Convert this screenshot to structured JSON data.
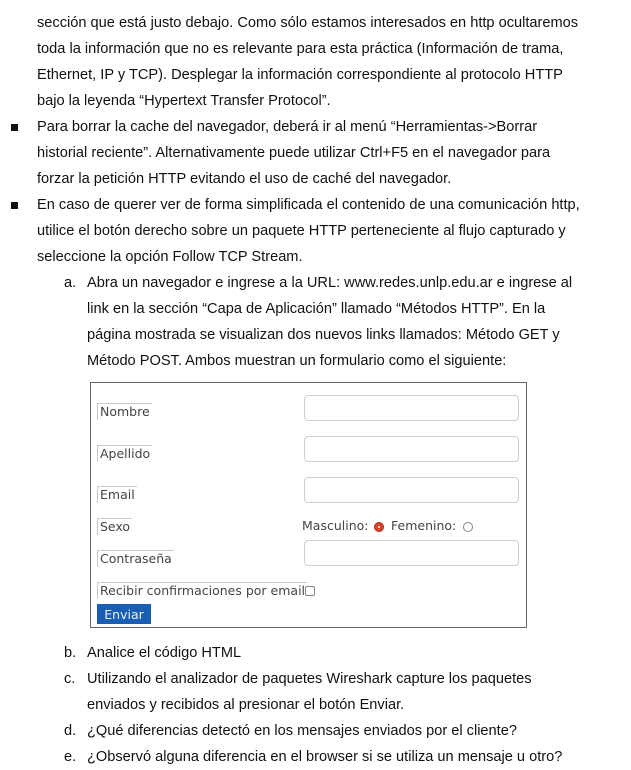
{
  "intro_lines": [
    "sección que está justo debajo. Como sólo estamos interesados en http ocultaremos",
    "toda la información que no es relevante para esta práctica (Información de trama,",
    "Ethernet, IP y TCP). Desplegar la información correspondiente al protocolo HTTP",
    "bajo la leyenda “Hypertext Transfer Protocol”."
  ],
  "bullets": [
    {
      "lines": [
        "Para borrar la cache del navegador, deberá ir al menú “Herramientas->Borrar",
        "historial reciente”. Alternativamente puede utilizar Ctrl+F5 en el navegador para",
        "forzar la petición HTTP evitando el uso de caché del navegador."
      ]
    },
    {
      "lines": [
        "En caso de querer ver de forma simplificada el contenido de una comunicación http,",
        "utilice el botón derecho sobre un paquete HTTP perteneciente al flujo capturado y",
        "seleccione la opción Follow TCP Stream."
      ]
    }
  ],
  "steps": [
    {
      "marker": "a.",
      "lines": [
        "Abra un navegador e ingrese a la URL: www.redes.unlp.edu.ar e ingrese al",
        "link en la sección “Capa de Aplicación” llamado “Métodos HTTP”. En la",
        "página mostrada se visualizan dos nuevos links llamados: Método GET y",
        "Método POST. Ambos muestran un formulario como el siguiente:"
      ]
    },
    {
      "marker": "b.",
      "lines": [
        "Analice el código HTML"
      ]
    },
    {
      "marker": "c.",
      "lines": [
        "Utilizando el analizador de paquetes Wireshark capture los paquetes",
        "enviados y recibidos al presionar el botón Enviar."
      ]
    },
    {
      "marker": "d.",
      "lines": [
        "¿Qué diferencias detectó en los mensajes enviados por el cliente?"
      ]
    },
    {
      "marker": "e.",
      "lines": [
        "¿Observó alguna diferencia en el browser si se utiliza un mensaje u otro?"
      ]
    }
  ],
  "form": {
    "nombre_label": "Nombre",
    "apellido_label": "Apellido",
    "email_label": "Email",
    "sexo_label": "Sexo",
    "masculino_label": "Masculino:",
    "femenino_label": "Femenino:",
    "selected_gender": "Masculino",
    "contrasena_label": "Contraseña",
    "confirm_label": "Recibir confirmaciones por email",
    "confirm_checked": false,
    "submit_label": "Enviar",
    "button_color": "#1a5fb4",
    "radio_selected_color": "#d9422e"
  }
}
